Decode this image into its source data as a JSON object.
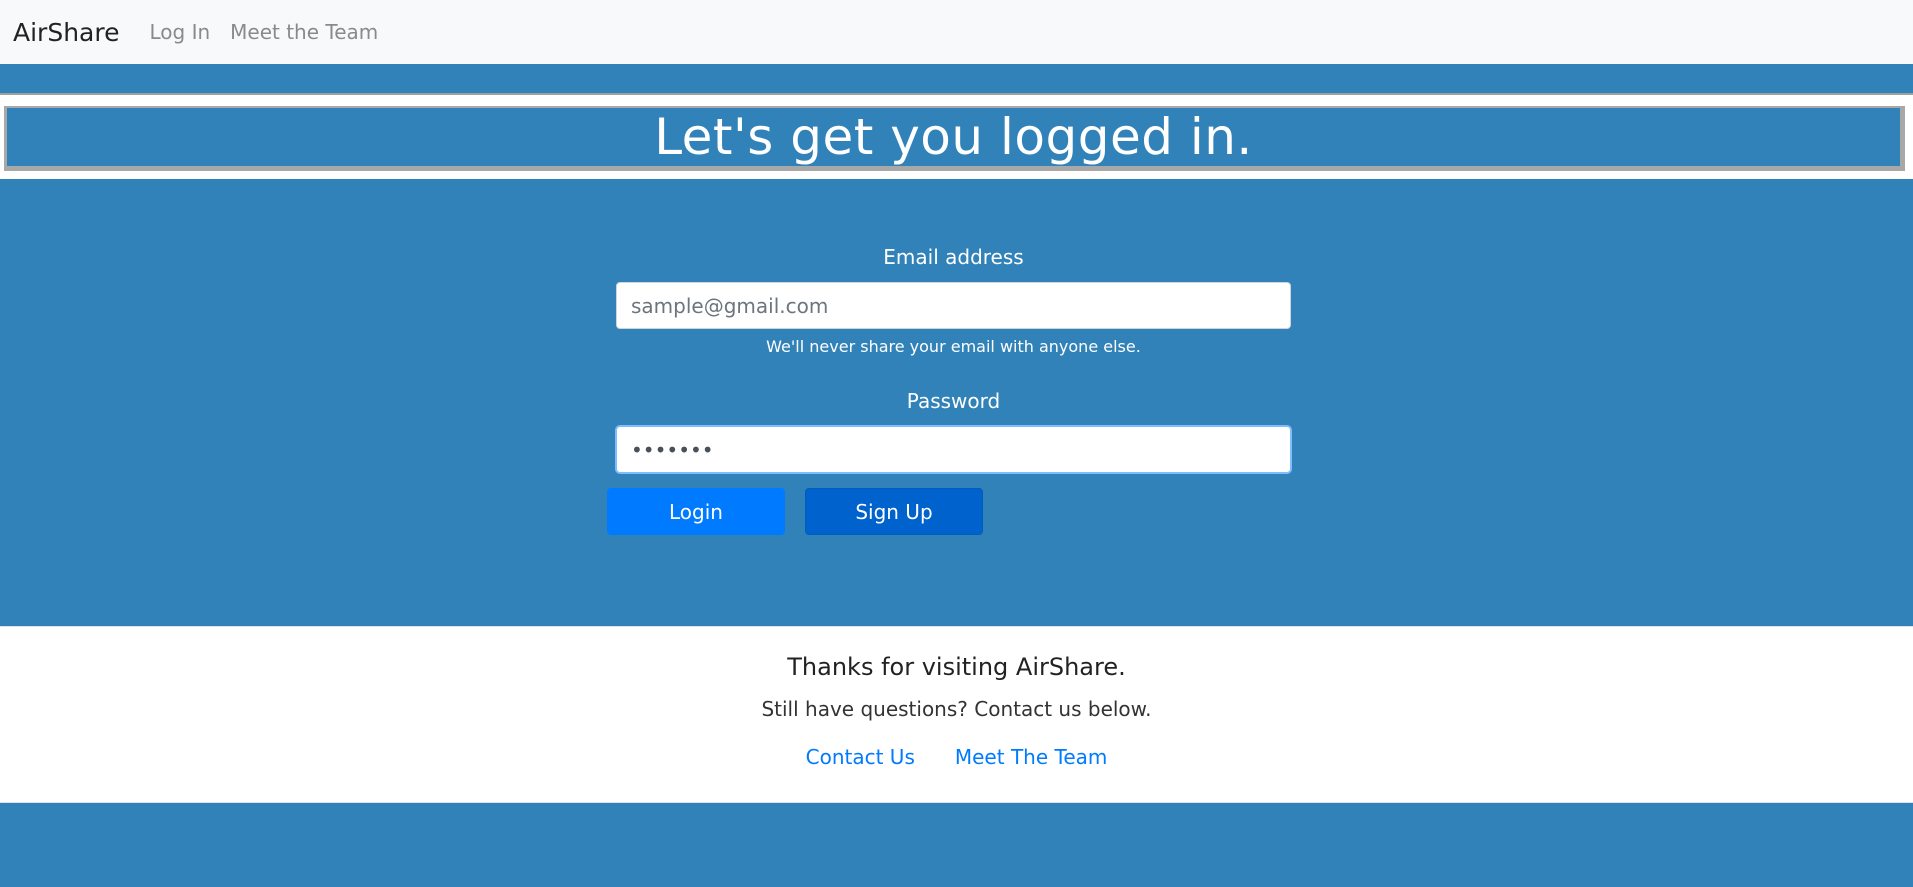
{
  "navbar": {
    "brand": "AirShare",
    "links": [
      "Log In",
      "Meet the Team"
    ]
  },
  "hero": {
    "title": "Let's get you logged in."
  },
  "form": {
    "email_label": "Email address",
    "email_placeholder": "sample@gmail.com",
    "email_value": "",
    "email_help": "We'll never share your email with anyone else.",
    "password_label": "Password",
    "password_value": "•••••••",
    "login_label": "Login",
    "signup_label": "Sign Up"
  },
  "footer": {
    "title": "Thanks for visiting AirShare.",
    "subtitle": "Still have questions? Contact us below.",
    "links": [
      "Contact Us",
      "Meet The Team"
    ]
  },
  "colors": {
    "page_bg": "#3182b8",
    "navbar_bg": "#f8f9fa",
    "primary": "#007bff",
    "primary_dark": "#0062cc"
  }
}
